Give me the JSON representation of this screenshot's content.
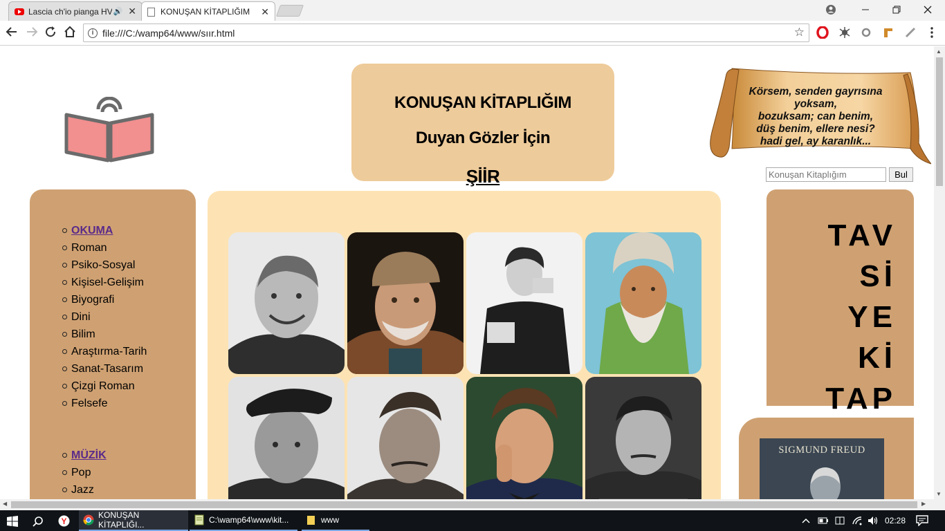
{
  "browser": {
    "tabs": [
      {
        "title": "Lascia ch'io pianga HV",
        "audio": "🔊",
        "active": false
      },
      {
        "title": "KONUŞAN KİTAPLIĞIM",
        "active": true
      }
    ],
    "close_glyph": "✕",
    "url": "file:///C:/wamp64/www/sıır.html"
  },
  "header": {
    "line1": "KONUŞAN KİTAPLIĞIM",
    "line2": "Duyan Gözler İçin",
    "line3": "ŞİİR"
  },
  "quote": {
    "lines": [
      "Körsem, senden gayrısına",
      "yoksam,",
      "bozuksam; can benim,",
      "düş benim, ellere nesi?",
      "hadi gel, ay karanlık..."
    ]
  },
  "search": {
    "value": "Konuşan Kitaplığım",
    "button": "Bul"
  },
  "menu": {
    "okuma": {
      "head": "OKUMA",
      "items": [
        "Roman",
        "Psiko-Sosyal",
        "Kişisel-Gelişim",
        "Biyografi",
        "Dini",
        "Bilim",
        "Araştırma-Tarih",
        "Sanat-Tasarım",
        "Çizgi Roman",
        "Felsefe"
      ]
    },
    "muzik": {
      "head": "MÜZİK",
      "items": [
        "Pop",
        "Jazz"
      ]
    }
  },
  "tavsiye": [
    "TAV",
    "Sİ",
    "YE",
    "Kİ",
    "TAP"
  ],
  "book": {
    "author": "SIGMUND FREUD"
  },
  "taskbar": {
    "items": [
      "KONUŞAN KİTAPLIĞI...",
      "C:\\wamp64\\www\\kit...",
      "www"
    ],
    "clock": "02:28"
  },
  "colors": {
    "header_bg": "#eecb9a",
    "side_panel_bg": "#cfa172",
    "center_panel_bg": "#fde3b4",
    "menu_link": "#5a2a8a"
  }
}
